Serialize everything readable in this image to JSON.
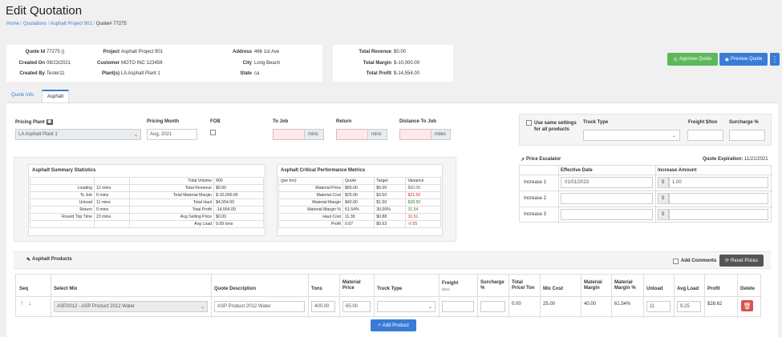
{
  "page": {
    "title": "Edit Quotation"
  },
  "breadcrumb": [
    "Home",
    "Quotations",
    "Asphalt Project 901",
    "Quote# 77275"
  ],
  "summary": {
    "quote_id_label": "Quote Id",
    "quote_id": "77275 ()",
    "created_on_label": "Created On",
    "created_on": "08/23/2021",
    "created_by_label": "Created By",
    "created_by": "Tester11",
    "project_label": "Project",
    "project": "Asphalt Project 901",
    "customer_label": "Customer",
    "customer": "MOTO INC 123456",
    "plants_label": "Plant(s)",
    "plants": "LA Asphalt Plant 1",
    "address_label": "Address",
    "address": "466 1st Ave",
    "city_label": "City",
    "city": "Long Beach",
    "state_label": "State",
    "state": "ca"
  },
  "totals": {
    "revenue_label": "Total Revenue",
    "revenue": "$0.00",
    "margin_label": "Total Margin",
    "margin": "$-10,000.00",
    "profit_label": "Total Profit",
    "profit": "$-14,554.00"
  },
  "actions": {
    "approve": "Approve Quote",
    "preview": "Preview Quote",
    "more": "⋮"
  },
  "tabs": [
    "Quote Info",
    "Asphalt"
  ],
  "pricing": {
    "plant_label": "Pricing Plant",
    "plant_value": "LA Asphalt Plant 1",
    "month_label": "Pricing Month",
    "month_value": "Aug, 2021",
    "fob_label": "FOB",
    "to_job_label": "To Job",
    "return_label": "Return",
    "distance_label": "Distance To Job",
    "mins": "mins",
    "miles": "miles"
  },
  "truck_settings": {
    "same_settings_label": "Use same settings for all products",
    "truck_type_label": "Truck Type",
    "freight_label": "Freight $/ton",
    "surcharge_label": "Surcharge %"
  },
  "escalator": {
    "title": "Price Escalator",
    "expiration_label": "Quote Expiration:",
    "expiration": "11/21/2021",
    "col_date": "Effective Date",
    "col_amount": "Increase Amount",
    "rows": [
      {
        "label": "Increase 1",
        "date": "01/01/2023",
        "currency": "$",
        "amount": "1.00"
      },
      {
        "label": "Increase 2",
        "date": "",
        "currency": "$",
        "amount": ""
      },
      {
        "label": "Increase 3",
        "date": "",
        "currency": "$",
        "amount": ""
      }
    ]
  },
  "stats": {
    "title": "Asphalt Summary Statistics",
    "left": [
      [
        "",
        ""
      ],
      [
        "Loading",
        "12 mins"
      ],
      [
        "To Job",
        "0 mins"
      ],
      [
        "Unload",
        "11 mins"
      ],
      [
        "Return",
        "0 mins"
      ],
      [
        "Round Trip Time",
        "23 mins"
      ],
      [
        "",
        ""
      ]
    ],
    "right": [
      [
        "Total Volume",
        "400"
      ],
      [
        "Total Revenue",
        "$0.00"
      ],
      [
        "Total Material Margin",
        "$-10,000.00"
      ],
      [
        "Total Haul",
        "$4,554.00"
      ],
      [
        "Total Profit",
        "-14,554.00"
      ],
      [
        "Avg Selling Price",
        "$0.00"
      ],
      [
        "Avg Load",
        "9.09 tons"
      ]
    ]
  },
  "perf": {
    "title": "Asphalt Critical Performance Metrics",
    "headers": [
      "(per ton)",
      "Quote",
      "Target",
      "Variance"
    ],
    "rows": [
      [
        "Material Price",
        "$65.00",
        "$5.00",
        "$60.00"
      ],
      [
        "Material Cost",
        "$25.00",
        "$3.50",
        "$21.50"
      ],
      [
        "Material Margin",
        "$40.00",
        "$1.50",
        "$38.50"
      ],
      [
        "Material Margin %",
        "61.54%",
        "30.00%",
        "31.54"
      ],
      [
        "Haul Cost",
        "11.39",
        "$0.88",
        "10.51"
      ],
      [
        "Profit",
        "0.07",
        "$0.63",
        "-0.55"
      ]
    ]
  },
  "products": {
    "title": "Asphalt Products",
    "add_comments": "Add Comments",
    "reset_prices": "Reset Prices",
    "add_product": "Add Product",
    "headers": {
      "seq": "Seq",
      "select_mix": "Select Mix",
      "quote_desc": "Quote Description",
      "tons": "Tons",
      "material_price": "Material Price",
      "truck_type": "Truck Type",
      "freight": "Freight",
      "freight_unit": "$/ton",
      "surcharge": "Surcharge %",
      "total_price": "Total Price/ Ton",
      "mix_cost": "Mix Cost",
      "material_margin": "Material Margin",
      "material_margin_pct": "Material Margin %",
      "unload": "Unload",
      "avg_load": "Avg Load",
      "profit": "Profit",
      "delete": "Delete"
    },
    "row": {
      "mix": "ASP2012 - ASP Product 2012 Water",
      "desc": "ASP Product 2012 Water",
      "tons": "400.00",
      "material_price": "65.00",
      "total_price": "0.00",
      "mix_cost": "25.00",
      "material_margin": "40.00",
      "material_margin_pct": "61.54%",
      "unload": "11",
      "avg_load": "9.25",
      "profit": "$28.62"
    }
  },
  "colors": {
    "approve": "#5cb85c",
    "preview": "#3a7bd5",
    "delete": "#d9534f",
    "reset": "#555555"
  }
}
